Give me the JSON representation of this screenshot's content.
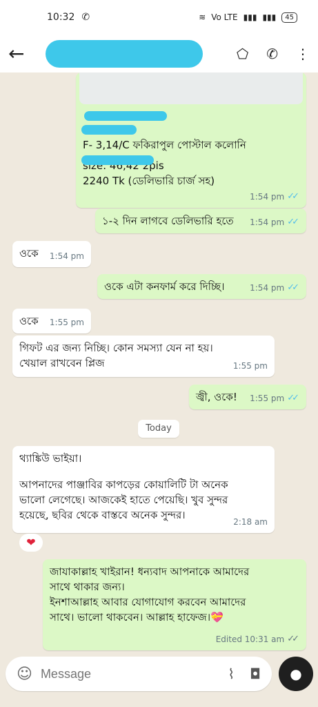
{
  "status": {
    "time": "10:32",
    "whatsapp_badge": "✆",
    "signal": "Vo LTE",
    "battery": "45"
  },
  "header": {
    "back_icon": "arrow-left-icon",
    "label_icon": "label-icon",
    "add_call_icon": "phone-plus-icon",
    "menu_icon": "more-vert-icon"
  },
  "messages": {
    "m1": {
      "line1": "F- 3,14/C  ফকিরাপুল পোস্টাল কলোনি",
      "line2": "size: 46,42    2pis",
      "line3": "2240 Tk (ডেলিভারি চার্জ সহ)",
      "time": "1:54 pm"
    },
    "m2": {
      "text": "১-২ দিন লাগবে ডেলিভারি হতে",
      "time": "1:54 pm"
    },
    "m3": {
      "text": "ওকে",
      "time": "1:54 pm"
    },
    "m4": {
      "text": "ওকে এটা কনফার্ম করে দিচ্ছি।",
      "time": "1:54 pm"
    },
    "m5": {
      "text": "ওকে",
      "time": "1:55 pm"
    },
    "m6": {
      "line1": "গিফট এর জন্য নিচ্ছি। কোন সমস্যা যেন না হয়।",
      "line2": "খেয়াল রাখবেন প্লিজ",
      "time": "1:55 pm"
    },
    "m7": {
      "text": "জ্বী, ওকে!",
      "time": "1:55 pm"
    },
    "day": "Today",
    "m8": {
      "line1": "থ্যাঙ্কিউ ভাইয়া।",
      "line2": "আপনাদের পাঞ্জাবির কাপড়ের  কোয়ালিটি টা অনেক",
      "line3": "ভালো লেগেছে। আজকেই হাতে পেয়েছি। খুব সুন্দর",
      "line4": "হয়েছে, ছবির থেকে বাস্তবে অনেক সুন্দর।",
      "time": "2:18 am",
      "reaction": "❤"
    },
    "m9": {
      "line1": "জাযাকাল্লাহ খাইরান!  ধন্যবাদ আপনাকে আমাদের",
      "line2": "সাথে থাকার জন্য।",
      "line3": "ইনশাআল্লাহ আবার যোগাযোগ করবেন আমাদের",
      "line4": "সাথে। ভালো থাকবেন। আল্লাহ হাফেজ।💝",
      "time": "Edited 10:31 am"
    }
  },
  "composer": {
    "placeholder": "Message",
    "emoji_icon": "sticker-icon",
    "attach_icon": "paperclip-icon",
    "camera_icon": "camera-icon",
    "mic_icon": "mic-icon"
  },
  "colors": {
    "outgoing": "#dcf8c6",
    "incoming": "#ffffff",
    "read_tick": "#53bdeb",
    "redaction": "#3ec8ea"
  }
}
